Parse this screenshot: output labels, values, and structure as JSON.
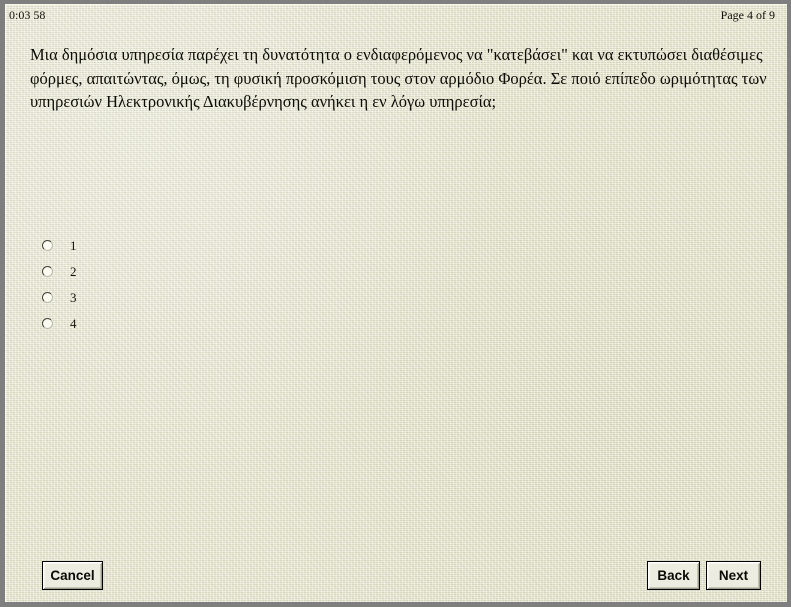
{
  "window": {
    "frame_color": "#7f7f7f",
    "page_background": "#e9e9d2",
    "text_color": "#0d0d07"
  },
  "header": {
    "timer": "0:03 58",
    "page_indicator": "Page 4 of 9"
  },
  "question": {
    "text": "Μια δημόσια υπηρεσία παρέχει τη δυνατότητα ο ενδιαφερόμενος να \"κατεβάσει\" και να εκτυπώσει διαθέσιμες φόρμες, απαιτώντας, όμως, τη φυσική προσκόμιση τους στον αρμόδιο Φορέα. Σε ποιό επίπεδο ωριμότητας των υπηρεσιών Ηλεκτρονικής Διακυβέρνησης ανήκει η εν λόγω υπηρεσία;"
  },
  "answers": {
    "selected": null,
    "options": [
      {
        "label": "1",
        "value": "1",
        "checked": false
      },
      {
        "label": "2",
        "value": "2",
        "checked": false
      },
      {
        "label": "3",
        "value": "3",
        "checked": false
      },
      {
        "label": "4",
        "value": "4",
        "checked": false
      }
    ]
  },
  "footer": {
    "cancel_label": "Cancel",
    "back_label": "Back",
    "next_label": "Next"
  }
}
